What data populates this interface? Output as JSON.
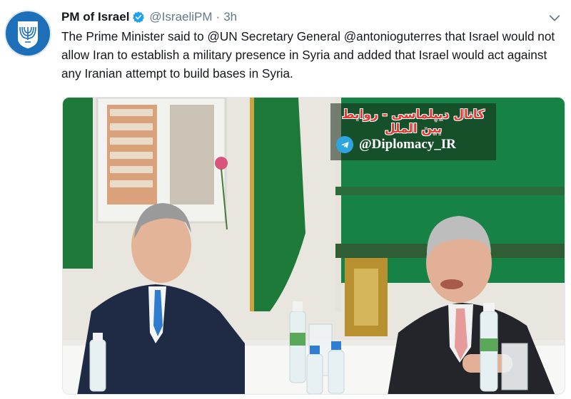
{
  "tweet": {
    "author_name": "PM of Israel",
    "handle": "@IsraeliPM",
    "separator": "·",
    "time": "3h",
    "text": "The Prime Minister said to @UN Secretary General @antonioguterres that Israel would not allow Iran to establish a military presence in Syria and added that Israel would act against any Iranian attempt to build bases in Syria."
  },
  "icons": {
    "avatar": "menorah-emblem-icon",
    "verified": "verified-badge-icon",
    "menu": "chevron-down-icon",
    "telegram": "telegram-icon"
  },
  "watermark": {
    "title": "کانال دیپلماسی - روابط بین الملل",
    "handle": "@Diplomacy_IR"
  },
  "colors": {
    "avatar_bg": "#1c6fb8",
    "verified": "#1da1f2",
    "secondary_text": "#657786",
    "curtain_green": "#1f7a3a",
    "watermark_red": "#e53935"
  }
}
